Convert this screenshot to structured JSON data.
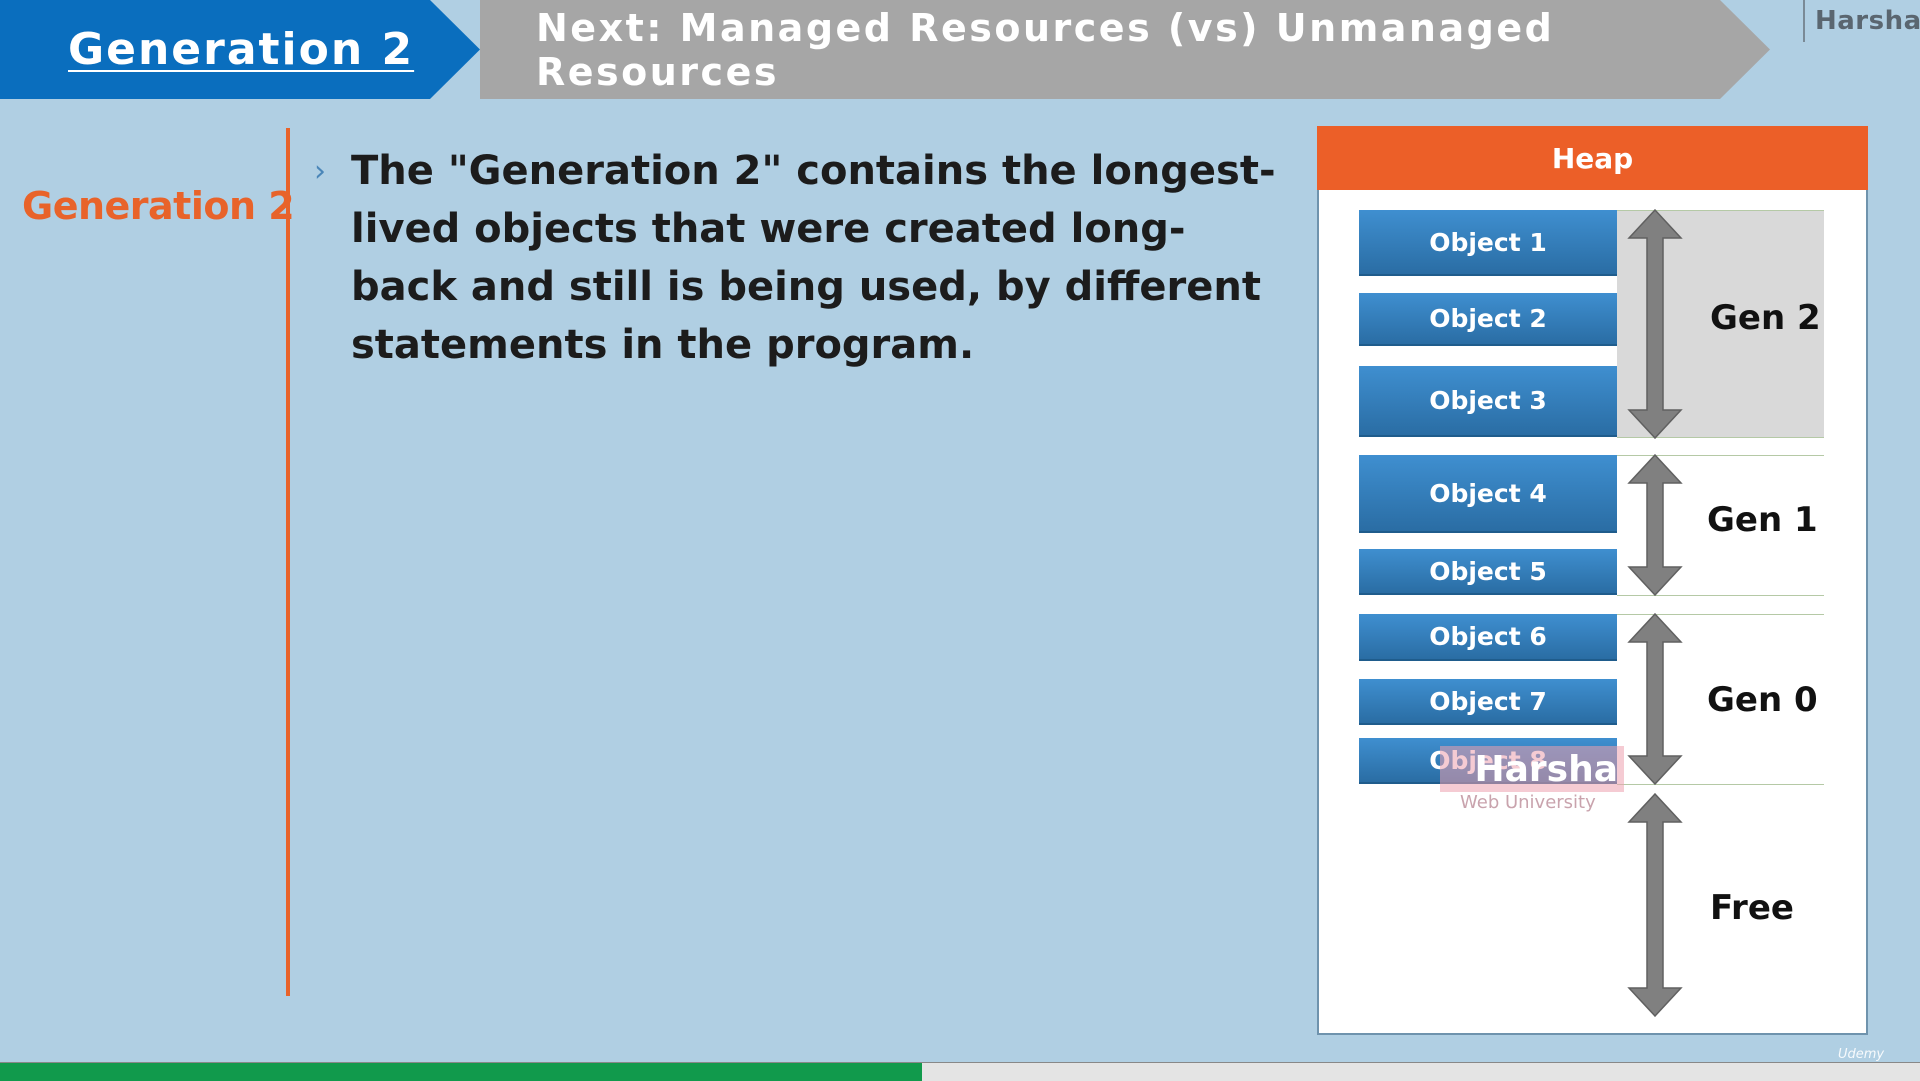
{
  "header": {
    "title": "Generation 2",
    "next": "Next: Managed Resources (vs) Unmanaged Resources",
    "brand": "Harsha"
  },
  "sidebar": {
    "label": "Generation 2"
  },
  "content": {
    "bullet_text": "The \"Generation 2\" contains the longest-lived objects that were created long-back and still is being used, by different statements in the program."
  },
  "diagram": {
    "title": "Heap",
    "objects": [
      "Object 1",
      "Object 2",
      "Object 3",
      "Object 4",
      "Object 5",
      "Object 6",
      "Object 7",
      "Object 8"
    ],
    "generations": [
      "Gen 2",
      "Gen 1",
      "Gen 0",
      "Free"
    ]
  },
  "watermark": {
    "name": "Harsha",
    "sub": "Web University"
  },
  "player": {
    "progress": 0.48,
    "platform": "Udemy"
  },
  "colors": {
    "title_blue": "#0a6ebe",
    "accent_orange": "#ec5f28",
    "object_blue": "#2a6da4",
    "progress_green": "#119a4c"
  }
}
